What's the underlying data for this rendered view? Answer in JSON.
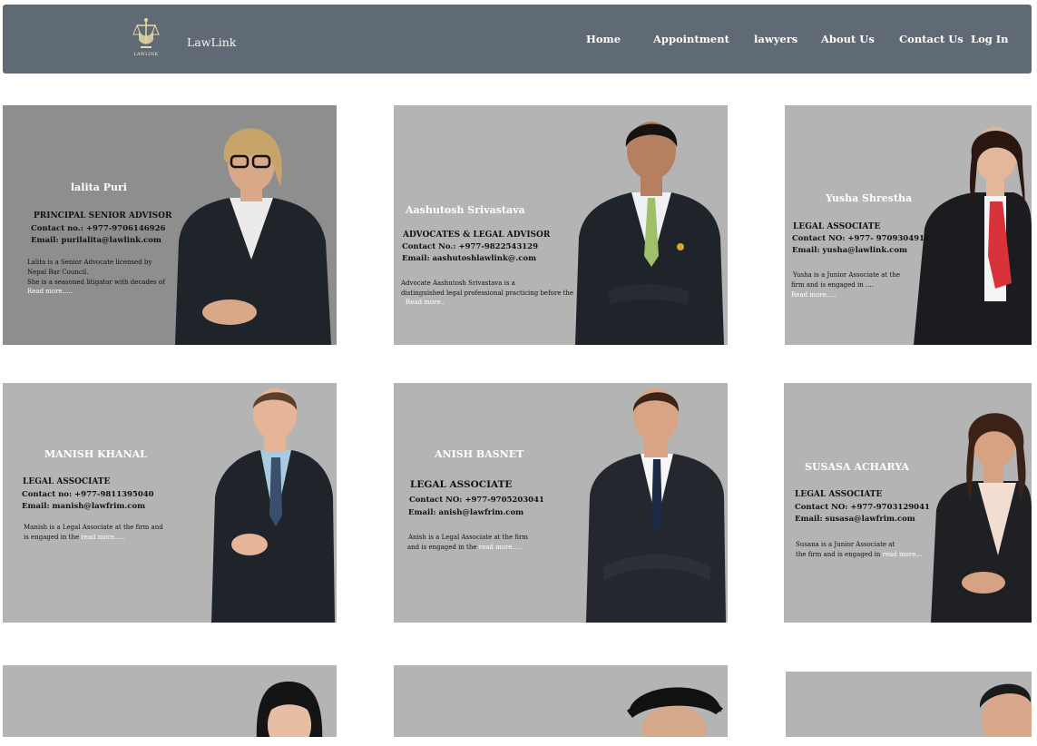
{
  "header": {
    "logo_text": "LAWLINK",
    "brand": "LawLink",
    "nav": [
      "Home",
      "Appointment",
      "lawyers",
      "About Us",
      "Contact Us",
      "Log In"
    ]
  },
  "lawyers": [
    {
      "name": "lalita Puri",
      "role": "PRINCIPAL SENIOR ADVISOR",
      "contact": "Contact no.: +977-9706146926",
      "email": "Email: purilalita@lawlink.com",
      "bio1": "Lalita is a Senior Advocate licensed by",
      "bio2": "Nepal Bar Council.",
      "bio3": "She is a seasoned litigator with decades of",
      "read_more": "Read more....."
    },
    {
      "name": "Aashutosh Srivastava",
      "role": "ADVOCATES & LEGAL ADVISOR",
      "contact": "Contact No.: +977-9822543129",
      "email": "Email: aashutoshlawlink@.com",
      "bio1": "Advocate Aashutosh Srivastava is a",
      "bio2": "distinguished legal professional practicing   before the",
      "read_more": "Read more.."
    },
    {
      "name": "Yusha Shrestha",
      "role": "LEGAL ASSOCIATE",
      "contact": "Contact NO: +977- 9709304911",
      "email": "Email: yusha@lawlink.com",
      "bio1": "Yusha  is a Junior Associate at the",
      "bio2": "firm and  is engaged in ....",
      "read_more": "Read more....."
    },
    {
      "name": "MANISH KHANAL",
      "role": "LEGAL ASSOCIATE",
      "contact": "Contact no: +977-9811395040",
      "email": "Email: manish@lawfrim.com",
      "bio1": "Manish is a Legal Associate at the firm and",
      "bio2": "is engaged in the",
      "read_more": "read more....."
    },
    {
      "name": "ANISH BASNET",
      "role": "LEGAL ASSOCIATE",
      "contact": "Contact NO: +977-9705203041",
      "email": "Email: anish@lawfrim.com",
      "bio1": "Anish is a Legal Associate at the firm",
      "bio2": "and is engaged in the",
      "read_more": "read more....."
    },
    {
      "name": "SUSASA ACHARYA",
      "role": "LEGAL ASSOCIATE",
      "contact": "Contact NO: +977-9703129041",
      "email": "Email: susasa@lawfrim.com",
      "bio1": "Susana is a Junior Associate at",
      "bio2": "the  firm and is engaged in",
      "read_more": "read more..."
    }
  ],
  "colors": {
    "navbar": "#606a74",
    "card_bg": "#b4b4b4",
    "card_bg_dark": "#8e8e8e",
    "suit": "#1f232a",
    "skin": "#c99273",
    "tie_red": "#d8323a"
  }
}
